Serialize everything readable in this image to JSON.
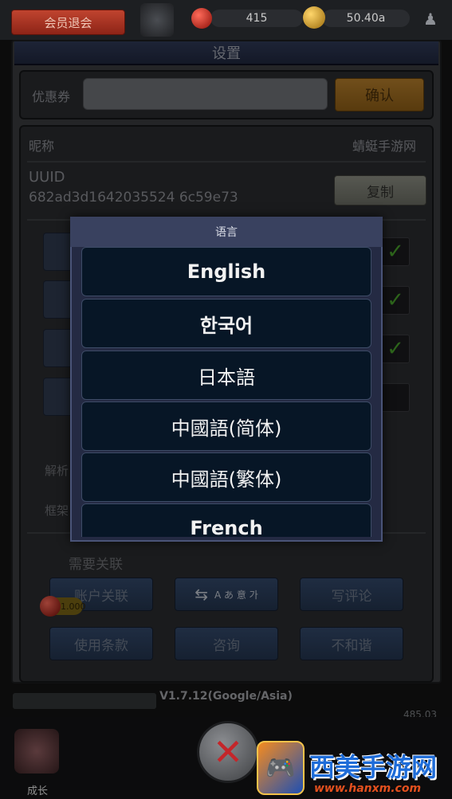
{
  "hud": {
    "member_button": "会员退会",
    "gems": "415",
    "gold": "50.40a"
  },
  "settings": {
    "title": "设置",
    "coupon_label": "优惠券",
    "coupon_placeholder": "",
    "confirm_label": "确认",
    "nickname_label": "昵称",
    "nickname_value": "蜻蜓手游网",
    "uuid_label": "UUID",
    "uuid_value": "682ad3d1642035524 6c59e73",
    "copy_label": "复制",
    "side_labels": [
      "解析",
      "框架"
    ],
    "link_required": "需要关联",
    "buttons_row1": [
      "账户关联",
      "写评论"
    ],
    "language_icon": "A あ 意 가",
    "buttons_row2": [
      "使用条款",
      "咨询",
      "不和谐"
    ],
    "gem_badge": "1.000",
    "version": "V1.7.12(Google/Asia)",
    "right_count": "485.03"
  },
  "bottom": {
    "left_label": "成长"
  },
  "watermark": {
    "title": "西美手游网",
    "url": "www.hanxm.com"
  },
  "language_dialog": {
    "title": "语言",
    "items": [
      "English",
      "한국어",
      "日本語",
      "中國語(简体)",
      "中國語(繁体)",
      "French"
    ]
  }
}
